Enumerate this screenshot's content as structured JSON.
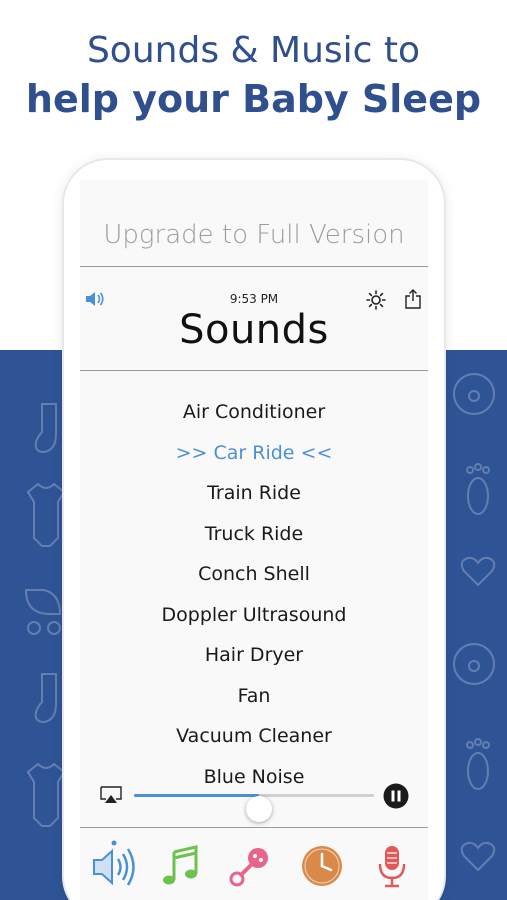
{
  "headline": {
    "line1": "Sounds & Music to",
    "line2": "help your Baby Sleep"
  },
  "app": {
    "upgrade_banner": "Upgrade to Full Version",
    "status_time": "9:53 PM",
    "screen_title": "Sounds",
    "sounds": [
      {
        "label": "Air Conditioner",
        "selected": false
      },
      {
        "label": ">> Car Ride <<",
        "selected": true
      },
      {
        "label": "Train Ride",
        "selected": false
      },
      {
        "label": "Truck Ride",
        "selected": false
      },
      {
        "label": "Conch Shell",
        "selected": false
      },
      {
        "label": "Doppler Ultrasound",
        "selected": false
      },
      {
        "label": "Hair Dryer",
        "selected": false
      },
      {
        "label": "Fan",
        "selected": false
      },
      {
        "label": "Vacuum Cleaner",
        "selected": false
      },
      {
        "label": "Blue Noise",
        "selected": false
      }
    ],
    "player": {
      "volume_level": 0.52
    },
    "tabs": [
      {
        "icon": "speaker-icon",
        "active": true
      },
      {
        "icon": "music-note-icon",
        "active": false
      },
      {
        "icon": "rattle-icon",
        "active": false
      },
      {
        "icon": "clock-icon",
        "active": false
      },
      {
        "icon": "microphone-icon",
        "active": false
      }
    ]
  },
  "colors": {
    "headline": "#2f4f8f",
    "band": "#2f5496",
    "accent": "#4a90d9",
    "music_green": "#6cc24a",
    "rattle_pink": "#e8648a",
    "clock_orange": "#d98a4a",
    "mic_red": "#e05a5a"
  }
}
